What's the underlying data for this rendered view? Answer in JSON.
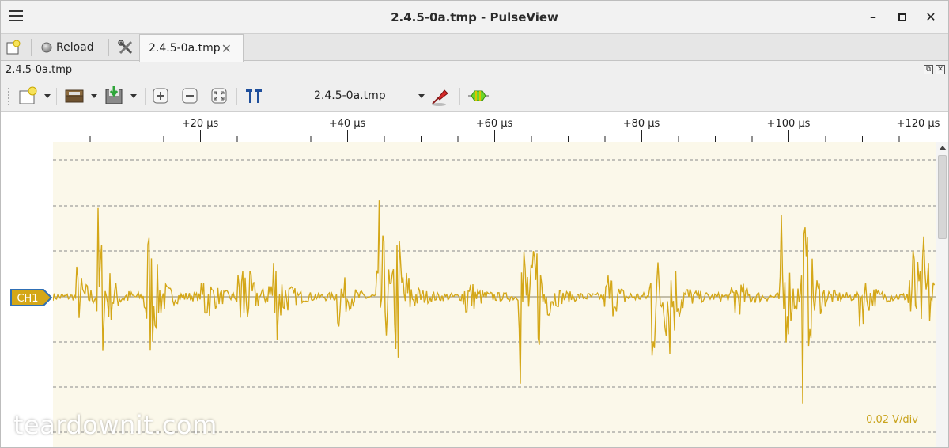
{
  "window": {
    "title": "2.4.5-0a.tmp - PulseView",
    "menu_icon": "hamburger-menu-icon",
    "minimize_symbol": "–",
    "maximize_symbol": "□",
    "close_symbol": "✕"
  },
  "tabs": {
    "new_session_icon": "new-session-icon",
    "reload_label": "Reload",
    "settings_icon": "settings-tools-icon",
    "active_tab_label": "2.4.5-0a.tmp",
    "close_symbol": "✕"
  },
  "session": {
    "label": "2.4.5-0a.tmp",
    "float_symbol": "⧉",
    "close_symbol": "✕"
  },
  "toolbar": {
    "device": "2.4.5-0a.tmp",
    "icons": [
      "new-view-icon",
      "open-file-icon",
      "save-file-icon",
      "zoom-in-icon",
      "zoom-out-icon",
      "zoom-fit-icon",
      "cursors-icon",
      "probe-config-icon",
      "add-decoder-icon"
    ]
  },
  "ruler": {
    "ticks": [
      "+20 µs",
      "+40 µs",
      "+60 µs",
      "+80 µs",
      "+100 µs",
      "+120 µs"
    ]
  },
  "trace": {
    "channel": "CH1",
    "scale": "0.02 V/div",
    "color": "#d4a718"
  },
  "watermark": "teardownit.com"
}
